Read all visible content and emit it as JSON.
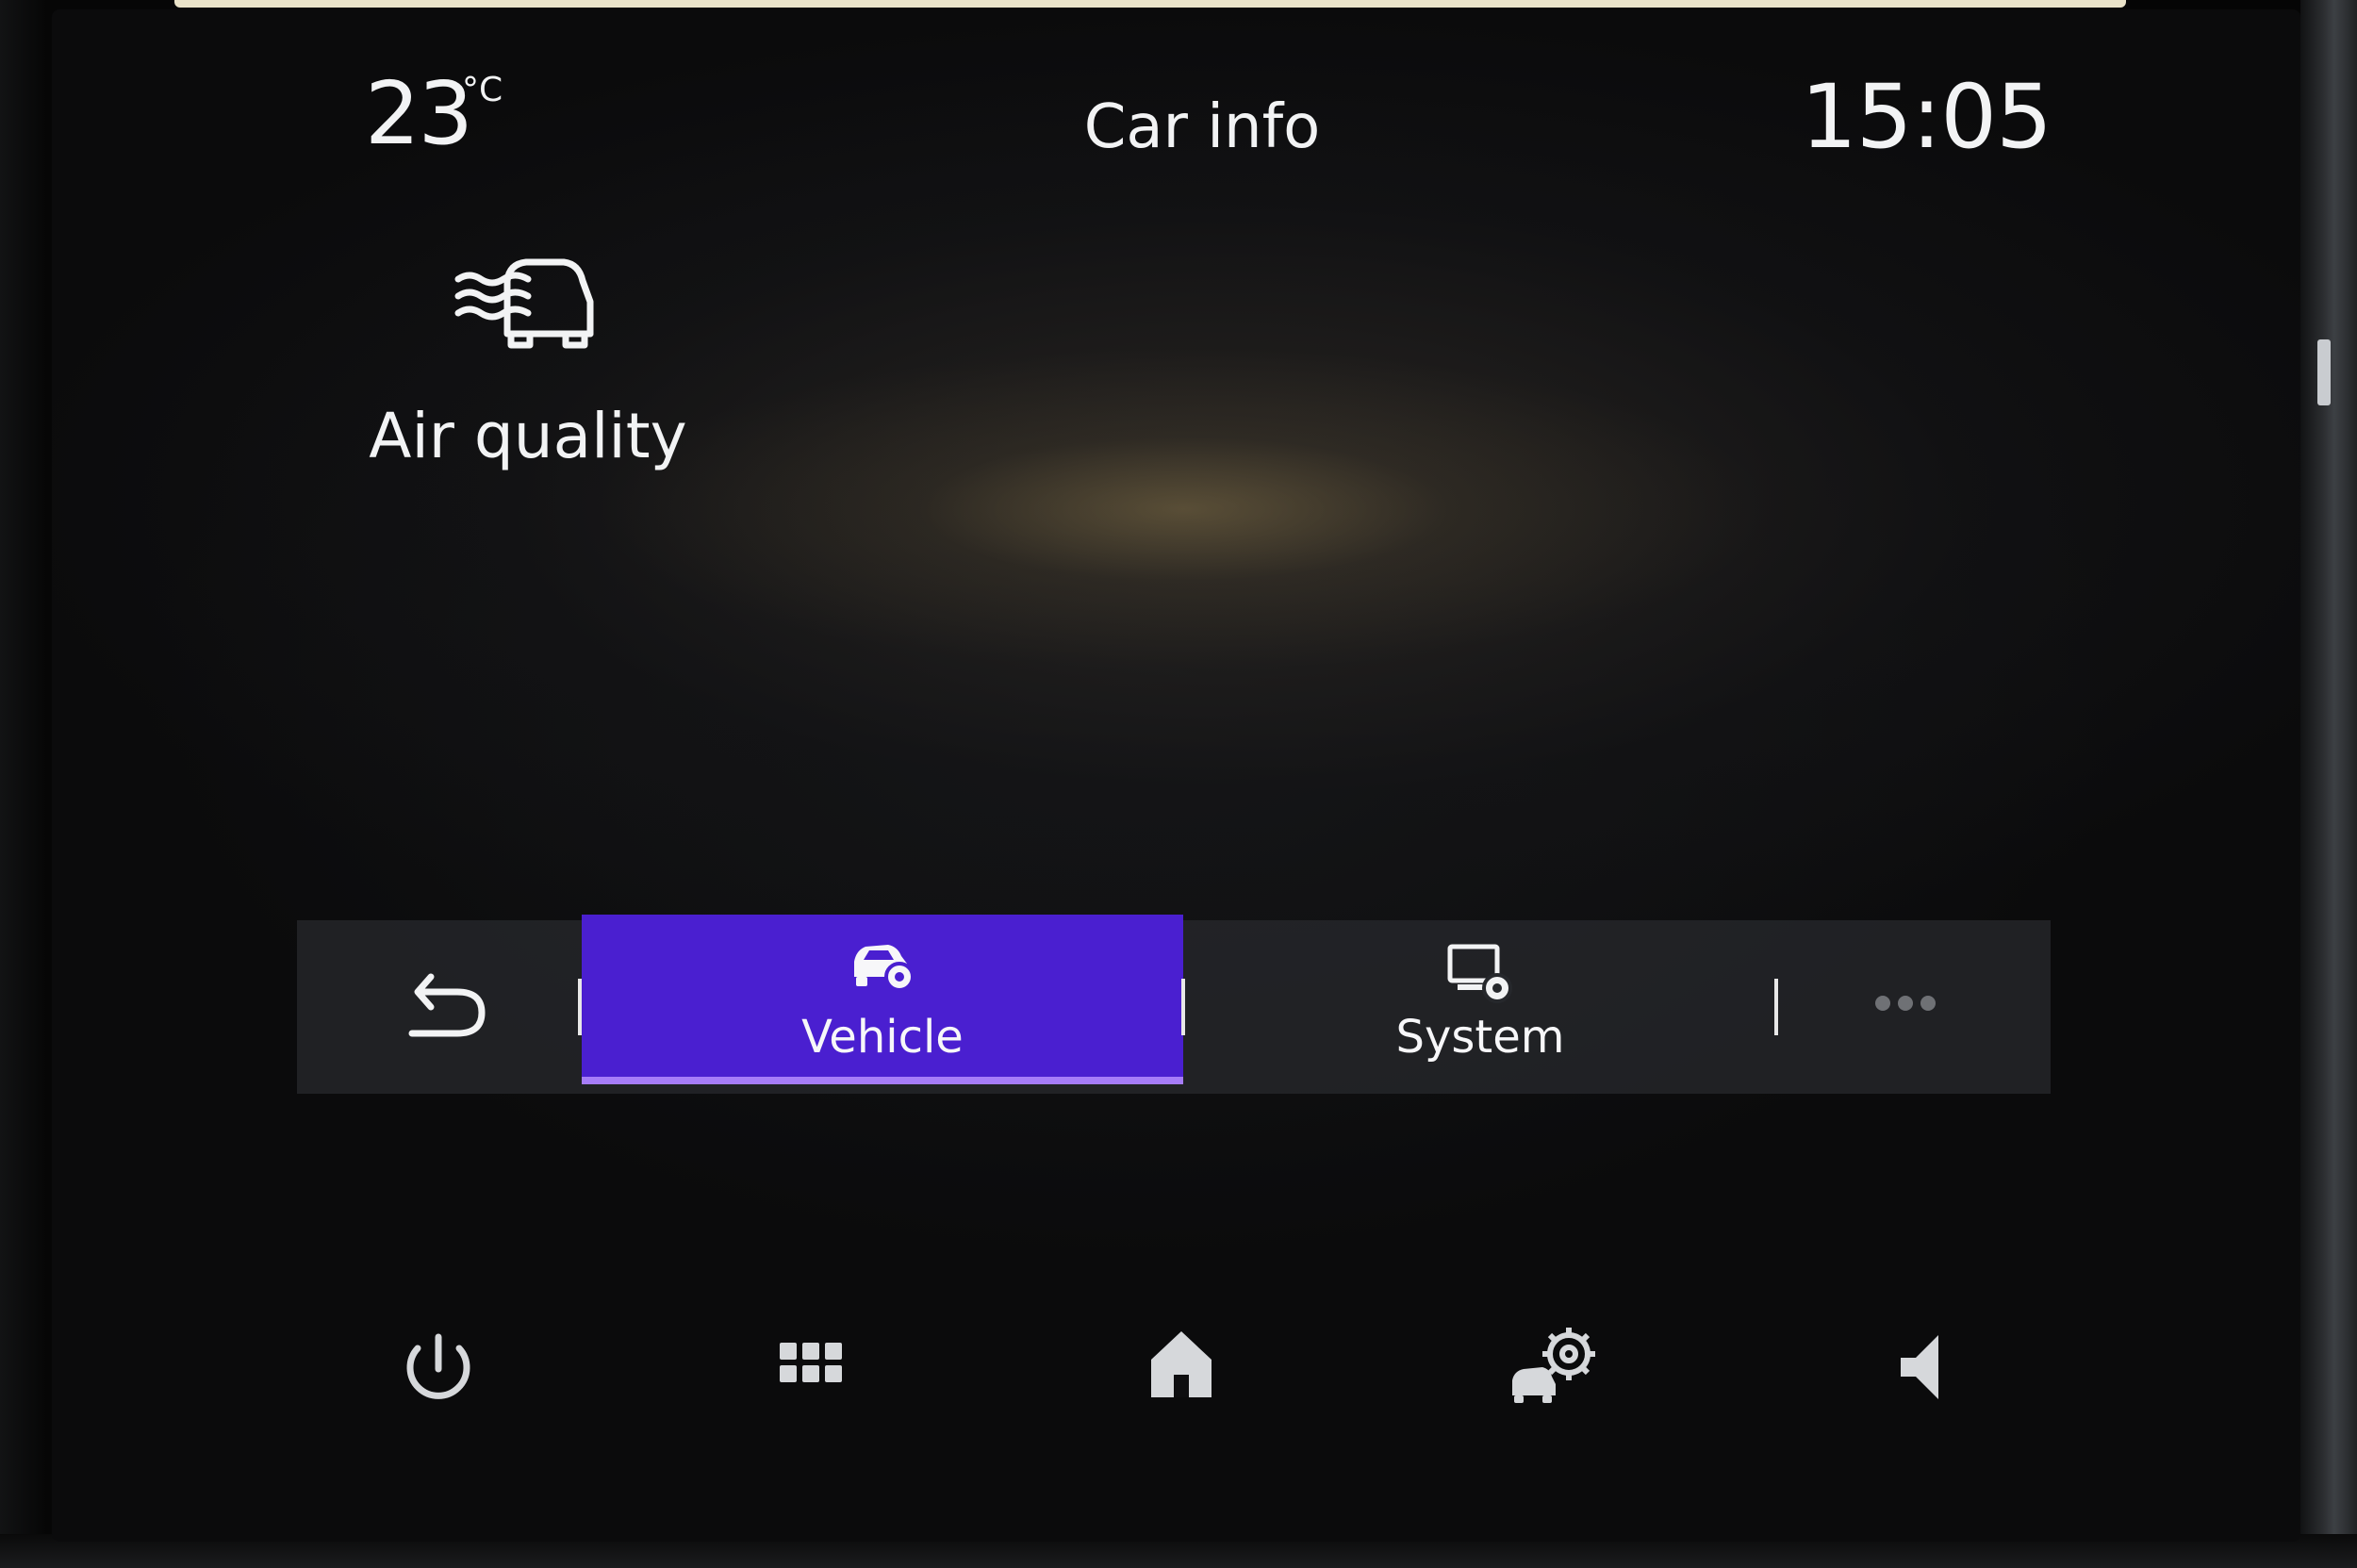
{
  "header": {
    "temperature": "23",
    "temperature_unit": "°C",
    "title": "Car info",
    "time": "15:05"
  },
  "tiles": [
    {
      "label": "Air quality",
      "icon": "air-quality-car-icon"
    }
  ],
  "tabbar": {
    "back_icon": "back-arrow-icon",
    "tabs": [
      {
        "label": "Vehicle",
        "icon": "vehicle-settings-icon",
        "active": true
      },
      {
        "label": "System",
        "icon": "system-settings-icon",
        "active": false
      }
    ],
    "more_icon": "more-dots-icon"
  },
  "dock": [
    {
      "icon": "power-icon"
    },
    {
      "icon": "apps-grid-icon"
    },
    {
      "icon": "home-icon"
    },
    {
      "icon": "car-settings-icon"
    },
    {
      "icon": "volume-icon"
    }
  ],
  "colors": {
    "active_tab": "#4a1fd0",
    "active_tab_underline": "#a67cf8",
    "text": "#f2f3f4",
    "icon_gray": "#d6d8db"
  }
}
